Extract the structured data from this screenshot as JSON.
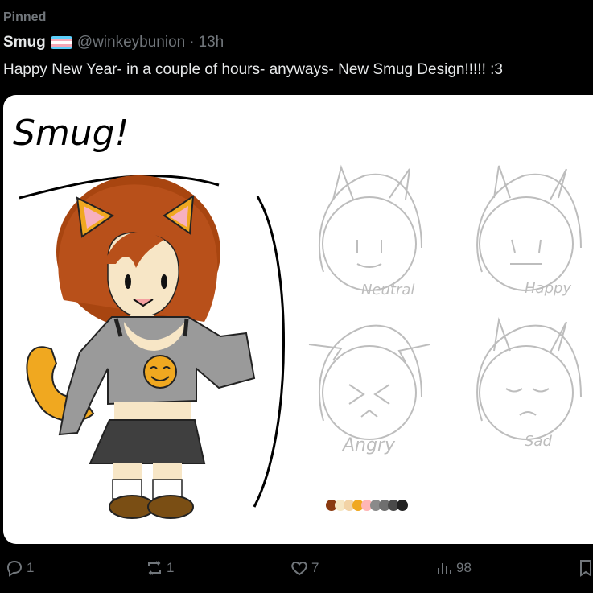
{
  "pinned_label": "Pinned",
  "author": {
    "name": "Smug",
    "handle": "@winkeybunion",
    "separator": "·",
    "time": "13h",
    "flag_colors": [
      "#5bcefa",
      "#f5a9b8",
      "#ffffff",
      "#f5a9b8",
      "#5bcefa"
    ]
  },
  "tweet_text": "Happy New Year- in a couple of hours- anyways- New Smug Design!!!!! :3",
  "media": {
    "title": "Smug!",
    "expressions": [
      "Neutral",
      "Happy",
      "Angry",
      "Sad"
    ],
    "palette": [
      "#8b3a10",
      "#f6e7c4",
      "#f2d3a5",
      "#f0a820",
      "#ffb6b6",
      "#8a8a8a",
      "#6f6f6f",
      "#4a4a4a",
      "#222222"
    ]
  },
  "actions": {
    "replies": "1",
    "reposts": "1",
    "likes": "7",
    "views": "98"
  }
}
